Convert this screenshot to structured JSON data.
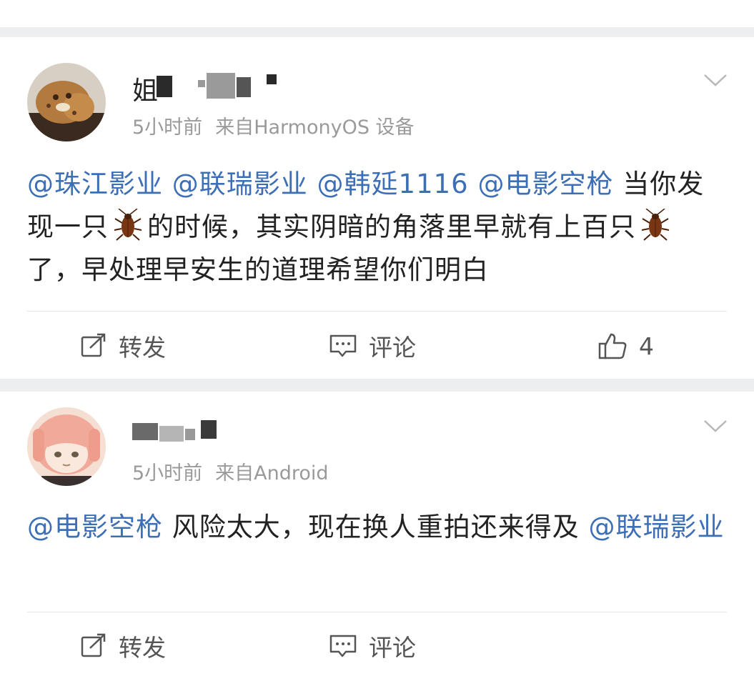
{
  "posts": [
    {
      "username_visible": "姐",
      "time": "5小时前",
      "source_prefix": "来自",
      "source_rest": "HarmonyOS 设备",
      "body_segments": {
        "m1": "@珠江影业",
        "m2": "@联瑞影业",
        "m3": "@韩延1116",
        "m4": "@电影空枪",
        "t1": " 当你发现一只",
        "t2": "的时候，其实阴暗的角落里早就有上百只",
        "t3": "了，早处理早安生的道理希望你们明白"
      },
      "emoji_icon": "cockroach-icon",
      "actions": {
        "repost": "转发",
        "comment": "评论",
        "like": "4"
      }
    },
    {
      "time": "5小时前",
      "source": "来自Android",
      "body_segments": {
        "m1": "@电影空枪",
        "t1": " 风险太大，现在换人重拍还来得及 ",
        "m2": "@联瑞影业"
      },
      "actions": {
        "repost": "转发",
        "comment": "评论"
      }
    }
  ],
  "colors": {
    "mention": "#3d6fb6",
    "meta": "#9a9a9a",
    "background": "#eceef0"
  }
}
